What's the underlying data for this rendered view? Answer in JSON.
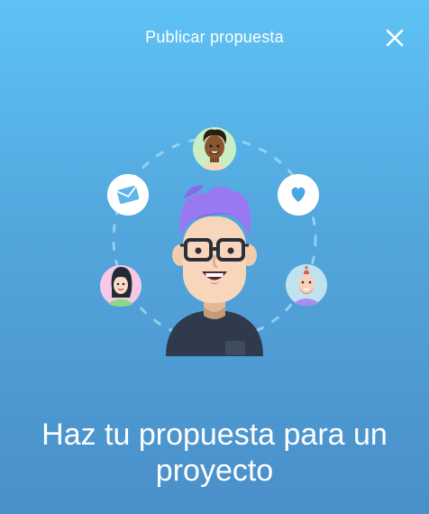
{
  "header": {
    "title": "Publicar propuesta",
    "close_icon": "close-icon"
  },
  "illustration": {
    "center": "developer-avatar-purple-hair-glasses",
    "orbit_items": [
      "avatar-man-dark-skin",
      "heart-icon",
      "avatar-man-mohawk-beard",
      "avatar-woman-black-hair",
      "mail-icon"
    ]
  },
  "main": {
    "headline": "Haz tu propuesta para un proyecto"
  },
  "colors": {
    "background_top": "#5ec2f5",
    "background_bottom": "#4a8fc9",
    "text": "#ffffff",
    "accent_purple": "#8c6cf0"
  }
}
